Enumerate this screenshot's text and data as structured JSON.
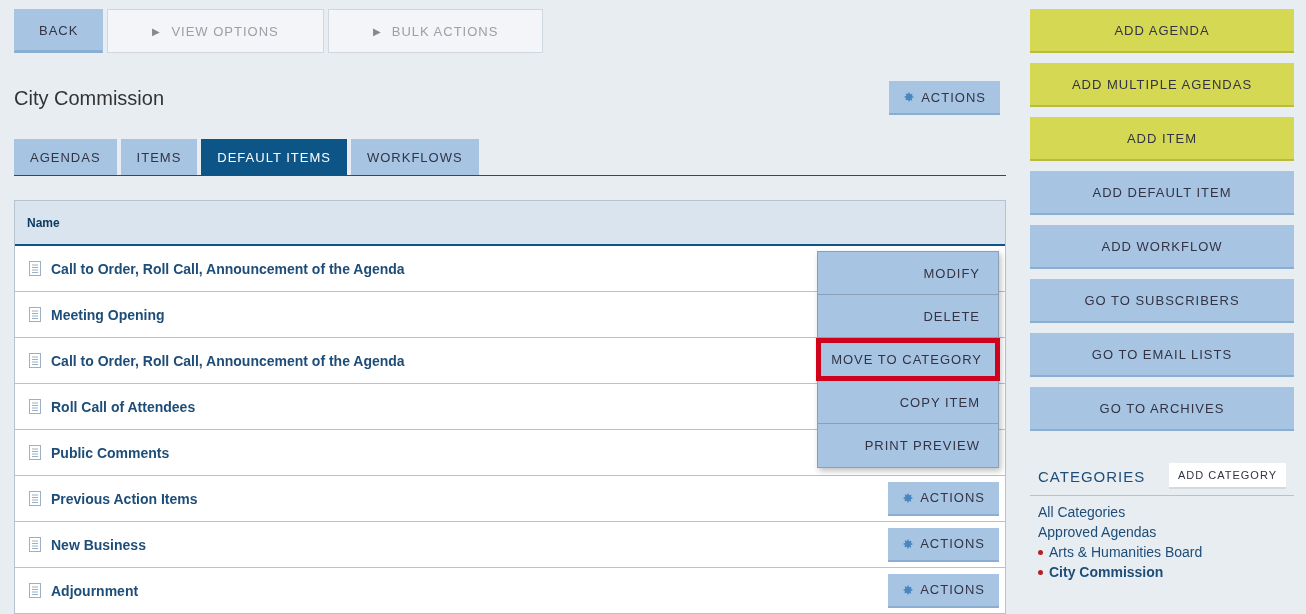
{
  "toolbar": [
    {
      "label": "BACK",
      "kind": "primary"
    },
    {
      "label": "VIEW OPTIONS",
      "kind": "toggle",
      "glyph": "▶"
    },
    {
      "label": "BULK ACTIONS",
      "kind": "toggle",
      "glyph": "▶"
    }
  ],
  "title": "City Commission",
  "title_action": "ACTIONS",
  "tabs": [
    {
      "label": "AGENDAS",
      "selected": false
    },
    {
      "label": "ITEMS",
      "selected": false
    },
    {
      "label": "DEFAULT ITEMS",
      "selected": true
    },
    {
      "label": "WORKFLOWS",
      "selected": false
    }
  ],
  "table": {
    "columns": [
      "Name"
    ],
    "rows": [
      {
        "name": "Call to Order, Roll Call, Announcement of the Agenda"
      },
      {
        "name": "Meeting Opening"
      },
      {
        "name": "Call to Order, Roll Call, Announcement of the Agenda"
      },
      {
        "name": "Roll Call of Attendees"
      },
      {
        "name": "Public Comments"
      },
      {
        "name": "Previous Action Items",
        "action": "ACTIONS"
      },
      {
        "name": "New Business",
        "action": "ACTIONS"
      },
      {
        "name": "Adjournment",
        "action": "ACTIONS"
      }
    ]
  },
  "action_menu": [
    {
      "label": "MODIFY",
      "highlighted": false
    },
    {
      "label": "DELETE",
      "highlighted": false
    },
    {
      "label": "MOVE TO CATEGORY",
      "highlighted": true
    },
    {
      "label": "COPY ITEM",
      "highlighted": false
    },
    {
      "label": "PRINT PREVIEW",
      "highlighted": false
    }
  ],
  "sidebar": {
    "buttons": [
      {
        "label": "ADD AGENDA",
        "kind": "accent"
      },
      {
        "label": "ADD MULTIPLE AGENDAS",
        "kind": "accent"
      },
      {
        "label": "ADD ITEM",
        "kind": "accent"
      },
      {
        "label": "ADD DEFAULT ITEM",
        "kind": "normal"
      },
      {
        "label": "ADD WORKFLOW",
        "kind": "normal"
      },
      {
        "label": "GO TO SUBSCRIBERS",
        "kind": "normal"
      },
      {
        "label": "GO TO EMAIL LISTS",
        "kind": "normal"
      },
      {
        "label": "GO TO ARCHIVES",
        "kind": "normal"
      }
    ],
    "categories_title": "CATEGORIES",
    "add_category": "ADD CATEGORY",
    "categories": [
      {
        "label": "All Categories",
        "bullet": false,
        "selected": false
      },
      {
        "label": "Approved Agendas",
        "bullet": false,
        "selected": false
      },
      {
        "label": "Arts & Humanities Board",
        "bullet": true,
        "selected": false
      },
      {
        "label": "City Commission",
        "bullet": true,
        "selected": true
      }
    ]
  }
}
